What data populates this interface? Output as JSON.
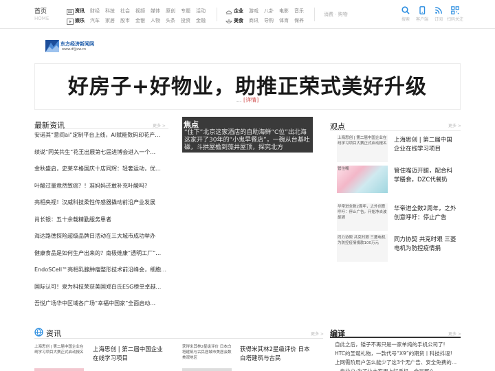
{
  "topnav": {
    "home": "首页",
    "home_sub": "HOME",
    "group1": {
      "row1": [
        "资讯",
        "财经",
        "科技",
        "社会",
        "视频",
        "媒体",
        "原创",
        "专题",
        "活动"
      ],
      "row2": [
        "娱乐",
        "汽车",
        "家居",
        "股市",
        "金银",
        "人物",
        "头条",
        "投资",
        "金融"
      ]
    },
    "group2": {
      "row1": [
        "企业",
        "游戏",
        "八卦",
        "电影",
        "音乐"
      ],
      "row2": [
        "美食",
        "商讯",
        "导购",
        "体育",
        "保养"
      ]
    },
    "consume": "消费 · 购物",
    "tools": [
      {
        "label": "搜索",
        "icon": "search-icon"
      },
      {
        "label": "客户端",
        "icon": "mobile-icon"
      },
      {
        "label": "订阅",
        "icon": "rss-icon"
      },
      {
        "label": "扫码关注",
        "icon": "qrcode-icon"
      }
    ]
  },
  "logo": {
    "name": "东方经济新闻网",
    "url": "www.dfjjxw.cn"
  },
  "headline": {
    "title": "好房子+好物业，助推正荣式美好升级",
    "dots": "...",
    "detail": "[详情]"
  },
  "latest": {
    "title": "最新资讯",
    "more": "更多 >",
    "items": [
      "安诺其“意间ai”定制平台上线，AI赋能数码印花产…",
      "续说“同美共生”花王出展第七届进博会进入一个…",
      "金秋盛启，史莱辛格国庆十店同辉：轻奢运动，优…",
      "叶酸过量竟然致癌？！准妈妈还敢补充叶酸吗?",
      "亮相央视！汉威科技柔性传感器撬动前沿产业发展",
      "肖长银：五十余载精勤服务患者",
      "海达路德探险超级品牌日活动在三大城市成功举办",
      "健康食品是如何生产出来的？南极维康“透明工厂”…",
      "EndoSCell™亮相乳腺肿瘤整形技术前沿峰会，细胞…",
      "国际认可！泉为科技荣获美国郑白氏ESG榜单卓越…",
      "吾悦广场华中区域各广场“幸福中国家”全面启动…"
    ]
  },
  "focus": {
    "title": "焦点",
    "text": "“住下”北京这家酒店的自助海鲜“C位”出北海这家开了30年的“小鬼早餐店”，一碗从台基吐磁，斗拱屋檐到藻井屋顶，探究北方"
  },
  "viewpoints": {
    "title": "观点",
    "more": "更多 >",
    "items": [
      {
        "img_alt": "上海思创 | 第二届中国企业在线学习项目大赛正式启动报名",
        "title": "上海思创 | 第二届中国企业在线学习项目",
        "has_photo": false
      },
      {
        "img_alt": "管住嘴",
        "title": "管住嘴迈开腿，配合科学膳食，DZC代餐奶",
        "has_photo": true
      },
      {
        "img_alt": "华帝进全数2周年，之外创意呼吁：停止广告，开始净去波旋骑",
        "title": "华帝进全数2周年，之外创意呼吁：停止广告",
        "has_photo": false
      },
      {
        "img_alt": "同力协契 共克时艰 三菱电机为防控疫情捐款100万元",
        "title": "同力协契 共克时艰 三菱电机为防控疫情捐",
        "has_photo": false
      }
    ]
  },
  "zixun": {
    "title": "资讯",
    "more": "更多 >",
    "items": [
      {
        "img_alt": "上海思创 | 第二届中国企业在线学习项目大赛正式启动报名",
        "title": "上海思创 | 第二届中国企业在线学习项目"
      },
      {
        "img_alt": "获得米其林2星级评价 日本白塔建筑与古民居城市美居会数美观地区",
        "title": "获得米其林2星级评价 日本白塔建筑与古民"
      }
    ]
  },
  "bianyi": {
    "title": "编译",
    "more": "更多 >",
    "items": [
      "自此之后，矮子不再只是一家单纯的手机公司了!",
      "HTC的圣诞礼物，一款代号“X9”的期货丨科技抖逗!",
      "上网需阶用户怎么能少了这3个无广告、安全免费的…",
      "…专业户·为了让大家用上好手机，全是那么…"
    ]
  }
}
